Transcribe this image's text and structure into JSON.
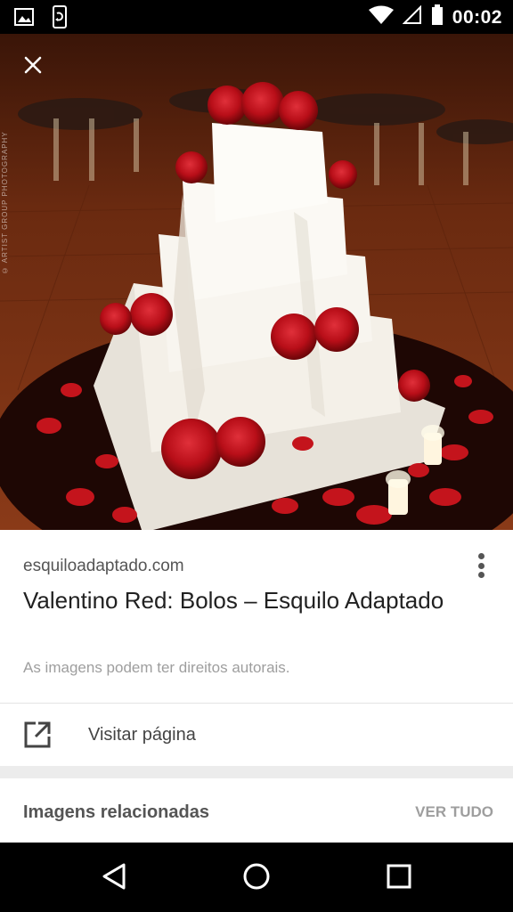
{
  "status_bar": {
    "time": "00:02",
    "icons": [
      "gallery-icon",
      "phone-rotate-icon",
      "wifi-icon",
      "signal-icon",
      "battery-icon"
    ]
  },
  "image": {
    "watermark": "© ARTIST GROUP PHOTOGRAPHY",
    "close_icon": "close-icon",
    "colors": {
      "floor": "#7a2e0f",
      "cake": "#f6f3ee",
      "rose": "#c4141c",
      "table": "#1e0704"
    }
  },
  "result": {
    "domain": "esquiloadaptado.com",
    "title": "Valentino Red: Bolos – Esquilo Adaptado",
    "copyright": "As imagens podem ter direitos autorais."
  },
  "visit": {
    "label": "Visitar página",
    "icon": "open-in-new-icon"
  },
  "related": {
    "title": "Imagens relacionadas",
    "view_all": "VER TUDO"
  },
  "nav": {
    "icons": [
      "back-icon",
      "home-icon",
      "recents-icon"
    ]
  }
}
